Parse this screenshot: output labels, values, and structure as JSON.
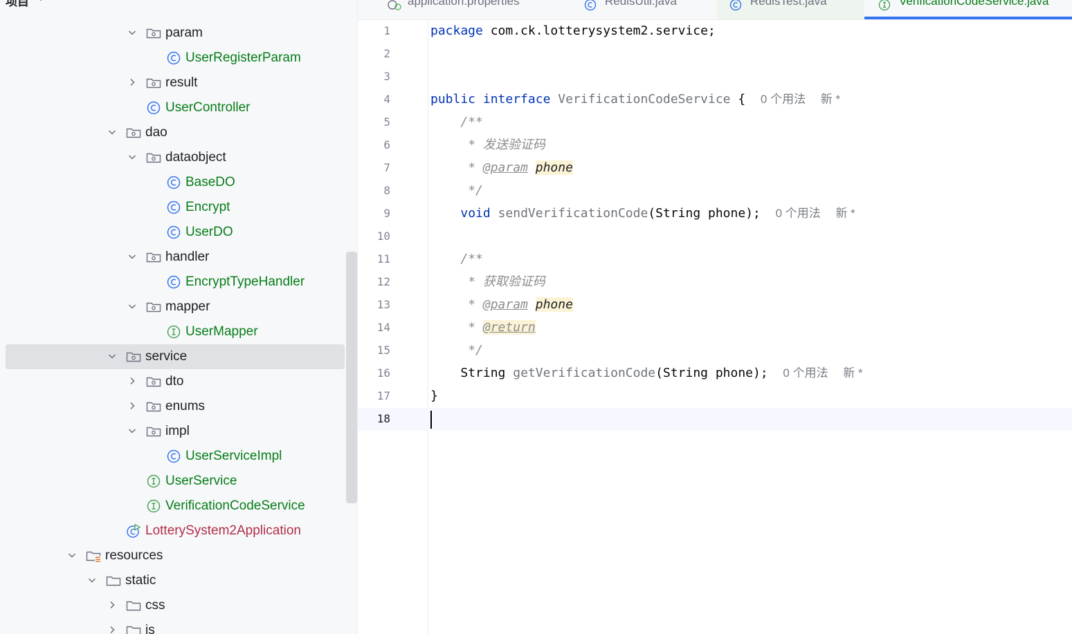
{
  "project_panel": {
    "title": "项目",
    "tree": [
      {
        "label": "param",
        "kind": "folder",
        "expanded": true,
        "color": "default"
      },
      {
        "label": "UserRegisterParam",
        "kind": "class",
        "color": "green"
      },
      {
        "label": "result",
        "kind": "folder",
        "expanded": false,
        "color": "default"
      },
      {
        "label": "UserController",
        "kind": "class",
        "color": "green"
      },
      {
        "label": "dao",
        "kind": "folder",
        "expanded": true,
        "color": "default"
      },
      {
        "label": "dataobject",
        "kind": "folder",
        "expanded": true,
        "color": "default"
      },
      {
        "label": "BaseDO",
        "kind": "class",
        "color": "green"
      },
      {
        "label": "Encrypt",
        "kind": "class",
        "color": "green"
      },
      {
        "label": "UserDO",
        "kind": "class",
        "color": "green"
      },
      {
        "label": "handler",
        "kind": "folder",
        "expanded": true,
        "color": "default"
      },
      {
        "label": "EncryptTypeHandler",
        "kind": "class",
        "color": "green"
      },
      {
        "label": "mapper",
        "kind": "folder",
        "expanded": true,
        "color": "default"
      },
      {
        "label": "UserMapper",
        "kind": "interface",
        "color": "green"
      },
      {
        "label": "service",
        "kind": "folder",
        "expanded": true,
        "color": "default",
        "selected": true
      },
      {
        "label": "dto",
        "kind": "folder",
        "expanded": false,
        "color": "default"
      },
      {
        "label": "enums",
        "kind": "folder",
        "expanded": false,
        "color": "default"
      },
      {
        "label": "impl",
        "kind": "folder",
        "expanded": true,
        "color": "default"
      },
      {
        "label": "UserServiceImpl",
        "kind": "class",
        "color": "green"
      },
      {
        "label": "UserService",
        "kind": "interface",
        "color": "green"
      },
      {
        "label": "VerificationCodeService",
        "kind": "interface",
        "color": "green"
      },
      {
        "label": "LotterySystem2Application",
        "kind": "app-class",
        "color": "red"
      },
      {
        "label": "resources",
        "kind": "resources-folder",
        "expanded": true,
        "color": "default"
      },
      {
        "label": "static",
        "kind": "plain-folder",
        "expanded": true,
        "color": "default"
      },
      {
        "label": "css",
        "kind": "plain-folder",
        "expanded": false,
        "color": "default"
      },
      {
        "label": "js",
        "kind": "plain-folder",
        "expanded": false,
        "color": "default"
      }
    ]
  },
  "tabs": [
    {
      "label": "application.properties",
      "icon": "properties-icon",
      "active": false
    },
    {
      "label": "RedisUtil.java",
      "icon": "class-icon",
      "active": false
    },
    {
      "label": "RedisTest.java",
      "icon": "class-icon",
      "active": false
    },
    {
      "label": "VerificationCodeService.java",
      "icon": "interface-icon",
      "active": true
    }
  ],
  "editor": {
    "package_kw": "package",
    "package_name": "com.ck.lotterysystem2.service;",
    "public_kw": "public",
    "interface_kw": "interface",
    "interface_name": "VerificationCodeService",
    "open_brace": "{",
    "usage_hint": "0 个用法",
    "new_hint": "新 *",
    "doc_open": "/**",
    "doc_star": "*",
    "doc_close": "*/",
    "doc1_text": "发送验证码",
    "param_tag": "@param",
    "param_name": "phone",
    "void_kw": "void",
    "send_method": "sendVerificationCode",
    "send_params": "(String phone);",
    "doc2_text": "获取验证码",
    "return_tag": "@return",
    "string_type": "String",
    "get_method": "getVerificationCode",
    "get_params": "(String phone);",
    "close_brace": "}",
    "line_numbers": [
      "1",
      "2",
      "3",
      "4",
      "5",
      "6",
      "7",
      "8",
      "9",
      "10",
      "11",
      "12",
      "13",
      "14",
      "15",
      "16",
      "17",
      "18"
    ],
    "current_line": 18
  }
}
